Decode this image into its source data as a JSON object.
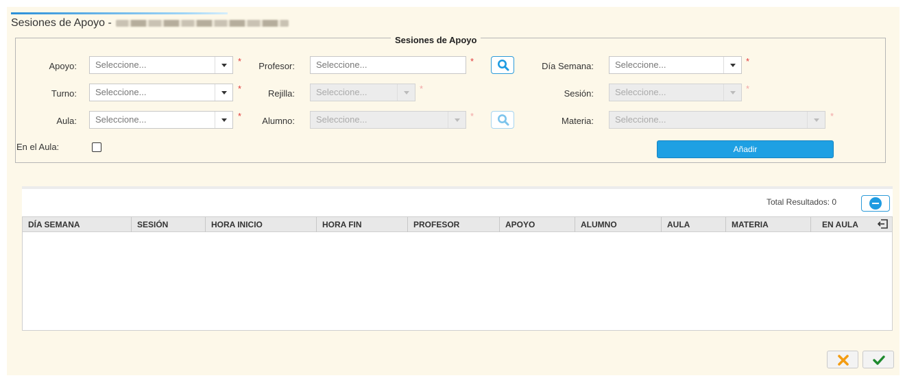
{
  "dialog": {
    "title": "Sesiones de Apoyo -",
    "fieldset_legend": "Sesiones de Apoyo"
  },
  "form": {
    "apoyo": {
      "label": "Apoyo:",
      "value": "Seleccione...",
      "required": "*"
    },
    "profesor": {
      "label": "Profesor:",
      "value": "Seleccione...",
      "required": "*"
    },
    "dia_semana": {
      "label": "Día Semana:",
      "value": "Seleccione...",
      "required": "*"
    },
    "turno": {
      "label": "Turno:",
      "value": "Seleccione...",
      "required": "*"
    },
    "rejilla": {
      "label": "Rejilla:",
      "value": "Seleccione...",
      "required": "*"
    },
    "sesion": {
      "label": "Sesión:",
      "value": "Seleccione...",
      "required": "*"
    },
    "aula": {
      "label": "Aula:",
      "value": "Seleccione...",
      "required": "*"
    },
    "alumno": {
      "label": "Alumno:",
      "value": "Seleccione...",
      "required": "*"
    },
    "materia": {
      "label": "Materia:",
      "value": "Seleccione...",
      "required": "*"
    },
    "en_el_aula": {
      "label": "En el Aula:",
      "checked": false
    },
    "add_button": "Añadir"
  },
  "results": {
    "total_label": "Total Resultados: 0",
    "columns": [
      "DÍA SEMANA",
      "SESIÓN",
      "HORA INICIO",
      "HORA FIN",
      "PROFESOR",
      "APOYO",
      "ALUMNO",
      "AULA",
      "MATERIA",
      "EN AULA"
    ],
    "rows": []
  },
  "colors": {
    "panel_bg": "#fdf8e9",
    "accent": "#1ea0e3",
    "required": "#e03b3b",
    "cancel": "#f39c12",
    "confirm": "#1e8a2e"
  },
  "icons": {
    "search": "search-icon",
    "collapse": "minus-circle-icon",
    "export": "exit-icon",
    "cancel": "close-icon",
    "confirm": "check-icon"
  }
}
